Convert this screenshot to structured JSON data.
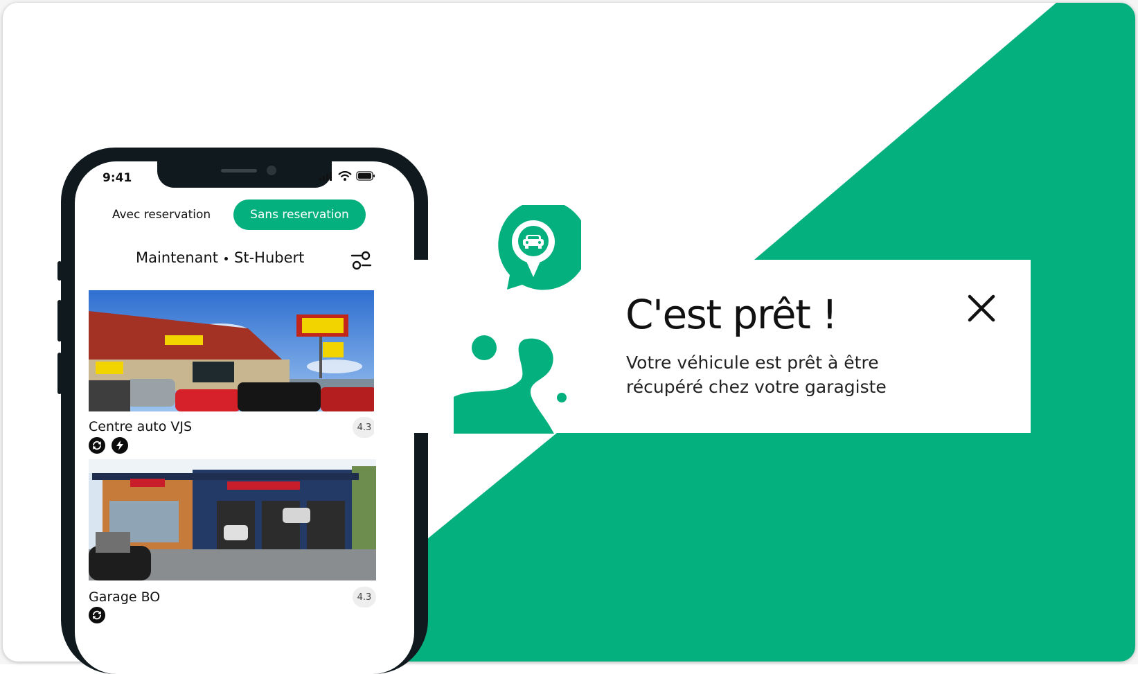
{
  "colors": {
    "brand_green": "#05b07f",
    "phone_frame": "#101a1e"
  },
  "status_bar": {
    "time": "9:41"
  },
  "tabs": [
    {
      "label": "Avec reservation",
      "selected": false
    },
    {
      "label": "Sans reservation",
      "selected": true
    }
  ],
  "filters": {
    "when": "Maintenant",
    "location": "St-Hubert"
  },
  "listings": [
    {
      "name": "Centre auto VJS",
      "rating": "4.3",
      "badges": [
        "sync-icon",
        "lightning-icon"
      ]
    },
    {
      "name": "Garage BO",
      "rating": "4.3",
      "badges": [
        "sync-icon"
      ]
    }
  ],
  "notification": {
    "title": "C'est prêt !",
    "message": "Votre véhicule est prêt à être récupéré chez votre garagiste"
  }
}
